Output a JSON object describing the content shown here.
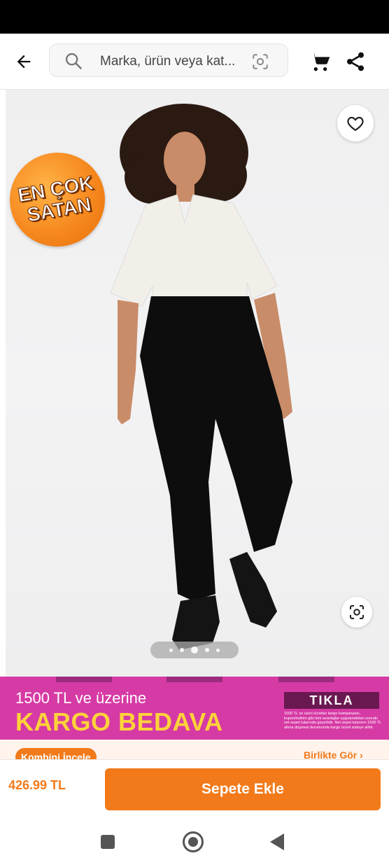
{
  "header": {
    "search_placeholder": "Marka, ürün veya kat...",
    "icons": {
      "back": "arrow-left-icon",
      "search": "search-icon",
      "visual_search": "camera-search-icon",
      "cart": "cart-icon",
      "share": "share-icon"
    }
  },
  "gallery": {
    "badge_line1": "EN ÇOK",
    "badge_line2": "SATAN",
    "image_count": 5,
    "active_image_index": 2,
    "icons": {
      "favorite": "heart-icon",
      "zoom": "visual-search-icon"
    },
    "image_description": "product-photo"
  },
  "banner": {
    "line1": "1500 TL ve üzerine",
    "line2": "KARGO BEDAVA",
    "cta": "TIKLA",
    "fine_print": "1500 TL ve üzeri ücretsiz kargo kampanyası, kupon/indirim gibi tüm avantajlar uygulandıktan sonraki net sepet tutarında geçerlidir. Net sepet tutarının 1500 TL altına düşmesi durumunda kargo ücreti sisteye alihir."
  },
  "kombin": {
    "left_label": "Kombini İncele",
    "right_label": "Birlikte Gör"
  },
  "buy_bar": {
    "price": "426.99 TL",
    "add_to_cart_label": "Sepete Ekle"
  },
  "colors": {
    "accent": "#f27a1a",
    "banner_bg": "#d63aa4",
    "banner_highlight": "#ffd23a"
  }
}
